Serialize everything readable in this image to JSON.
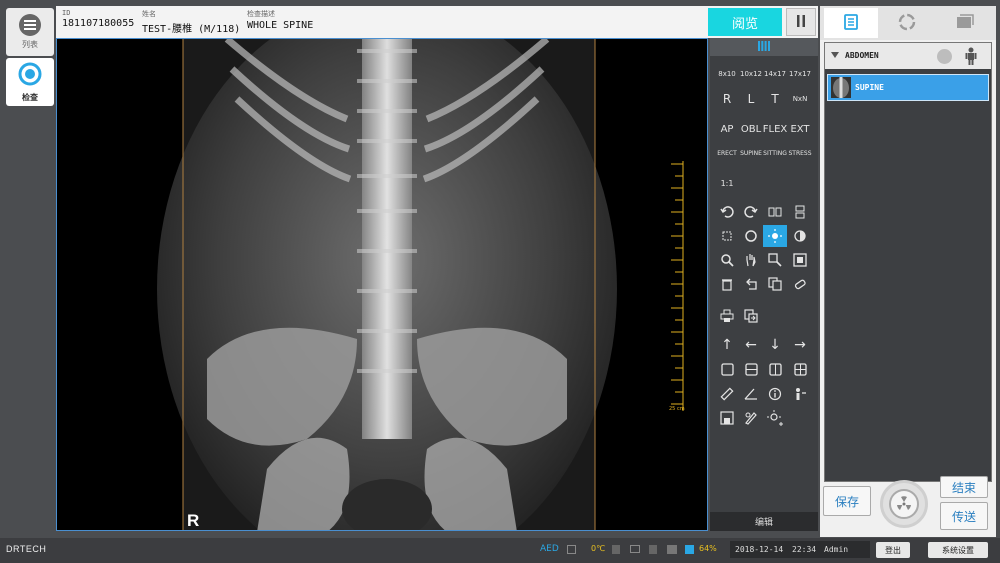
{
  "left_nav": {
    "list_label": "列表",
    "exam_label": "检查"
  },
  "patient": {
    "id_label": "ID",
    "id_value": "181107180055",
    "name_label": "姓名",
    "name_value": "TEST-腰椎 (M/118)",
    "desc_label": "检查描述",
    "desc_value": "WHOLE SPINE"
  },
  "toolbar": {
    "browse_label": "阅览"
  },
  "viewer": {
    "marker": "R",
    "ruler_label": "25 cm"
  },
  "tools": {
    "sizes": [
      "8x10",
      "10x12",
      "14x17",
      "17x17"
    ],
    "markers": [
      "R",
      "L",
      "T",
      "NxN"
    ],
    "views": [
      "AP",
      "OBL",
      "FLEX",
      "EXT"
    ],
    "positions": [
      "ERECT",
      "SUPINE",
      "SITTING",
      "STRESS"
    ],
    "ratio": "1:1",
    "edit_label": "编辑"
  },
  "right_panel": {
    "protocol_group": "ABDOMEN",
    "protocol_item": "SUPINE",
    "save_label": "保存",
    "finish_label": "结束",
    "send_label": "传送"
  },
  "statusbar": {
    "brand": "DRTECH",
    "aed": "AED",
    "temp": "0℃",
    "battery": "64%",
    "date": "2018-12-14",
    "time": "22:34",
    "user": "Admin",
    "logout_label": "登出",
    "settings_label": "系统设置"
  },
  "colors": {
    "accent": "#2aa7e4",
    "browse_button": "#19d6e0",
    "selected_row": "#3aa0e8"
  }
}
